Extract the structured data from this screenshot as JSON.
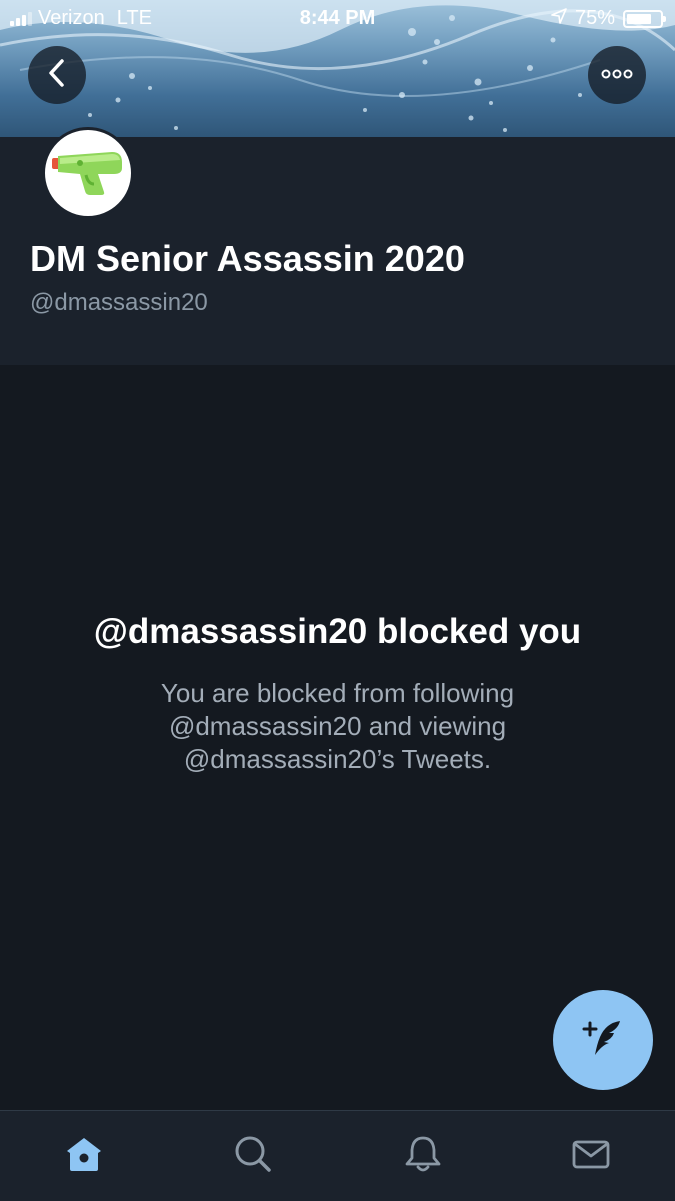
{
  "status_bar": {
    "carrier": "Verizon",
    "network": "LTE",
    "time": "8:44 PM",
    "battery": "75%",
    "battery_level": 0.75,
    "location_icon": "location-arrow-icon"
  },
  "profile": {
    "display_name": "DM Senior Assassin 2020",
    "handle": "@dmassassin20",
    "avatar_icon": "water-pistol-icon"
  },
  "blocked": {
    "title": "@dmassassin20 blocked you",
    "message": "You are blocked from following @dmassassin20 and viewing @dmassassin20’s Tweets."
  },
  "actions": {
    "back_icon": "chevron-left-icon",
    "more_icon": "more-dots-icon",
    "compose_icon": "compose-tweet-icon"
  },
  "tabs": [
    {
      "name": "home",
      "icon": "home-icon",
      "active": true
    },
    {
      "name": "search",
      "icon": "search-icon",
      "active": false
    },
    {
      "name": "notifications",
      "icon": "bell-icon",
      "active": false
    },
    {
      "name": "messages",
      "icon": "mail-icon",
      "active": false
    }
  ],
  "colors": {
    "accent": "#8ec5f3",
    "background": "#141920",
    "header_background": "#1b222c",
    "secondary_text": "#8b98a5"
  }
}
